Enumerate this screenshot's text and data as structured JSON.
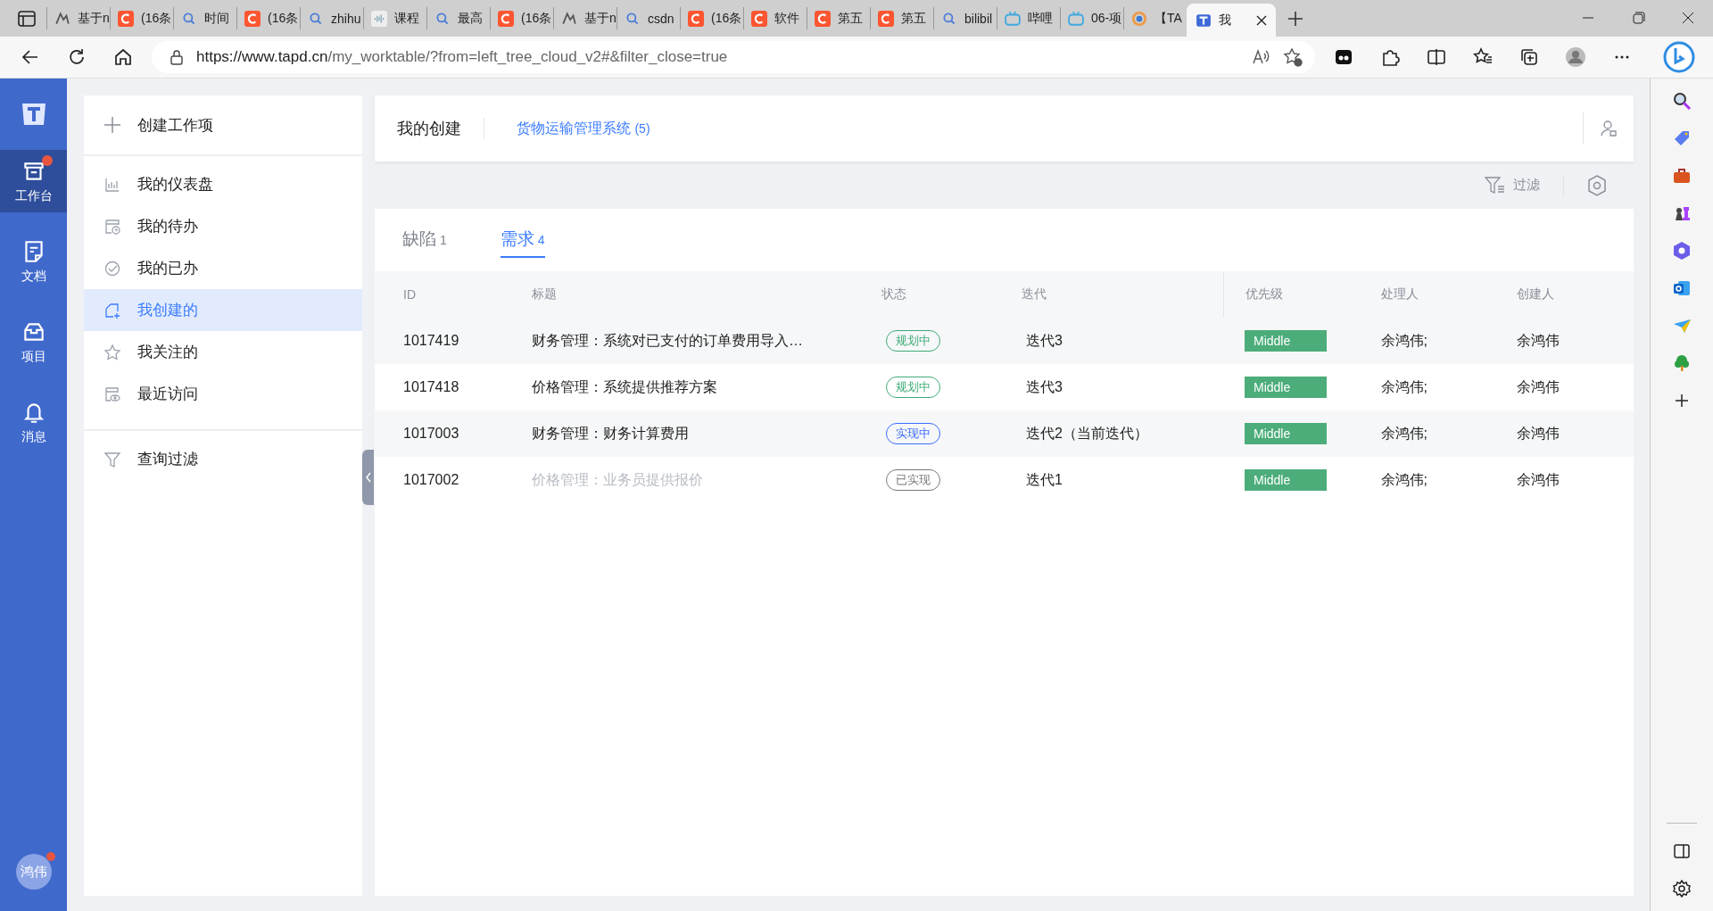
{
  "browser": {
    "tabs": [
      {
        "kind": "tapd",
        "title": "基于n",
        "selected": false
      },
      {
        "kind": "csdn",
        "title": "(16条",
        "selected": false
      },
      {
        "kind": "search",
        "title": "时间",
        "selected": false
      },
      {
        "kind": "csdn",
        "title": "(16条",
        "selected": false
      },
      {
        "kind": "search",
        "title": "zhihu",
        "selected": false
      },
      {
        "kind": "wave",
        "title": "课程",
        "selected": false
      },
      {
        "kind": "search",
        "title": "最高",
        "selected": false
      },
      {
        "kind": "csdn",
        "title": "(16条",
        "selected": false
      },
      {
        "kind": "tapd",
        "title": "基于n",
        "selected": false
      },
      {
        "kind": "search",
        "title": "csdn",
        "selected": false
      },
      {
        "kind": "csdn",
        "title": "(16条",
        "selected": false
      },
      {
        "kind": "csdn",
        "title": "软件",
        "selected": false
      },
      {
        "kind": "csdn",
        "title": "第五",
        "selected": false
      },
      {
        "kind": "csdn",
        "title": "第五",
        "selected": false
      },
      {
        "kind": "search",
        "title": "bilibil",
        "selected": false
      },
      {
        "kind": "tv",
        "title": "哔哩",
        "selected": false
      },
      {
        "kind": "tv",
        "title": "06-项",
        "selected": false
      },
      {
        "kind": "ring",
        "title": "【TA",
        "selected": false
      },
      {
        "kind": "logo",
        "title": "我",
        "selected": true
      }
    ],
    "url_host": "https://www.tapd.cn",
    "url_path": "/my_worktable/?from=left_tree_cloud_v2#&filter_close=true"
  },
  "nav": {
    "items": [
      {
        "kind": "archive",
        "label": "工作台",
        "selected": true,
        "badge": true
      },
      {
        "kind": "doc",
        "label": "文档",
        "selected": false,
        "badge": false
      },
      {
        "kind": "inbox",
        "label": "项目",
        "selected": false,
        "badge": false
      },
      {
        "kind": "bell",
        "label": "消息",
        "selected": false,
        "badge": false
      }
    ],
    "avatar": {
      "label": "鸿伟",
      "badge": true
    }
  },
  "sidebar": {
    "create": "创建工作项",
    "items": [
      {
        "kind": "chart",
        "label": "我的仪表盘",
        "selected": false
      },
      {
        "kind": "clock",
        "label": "我的待办",
        "selected": false
      },
      {
        "kind": "check",
        "label": "我的已办",
        "selected": false
      },
      {
        "kind": "newdoc",
        "label": "我创建的",
        "selected": true
      },
      {
        "kind": "star",
        "label": "我关注的",
        "selected": false
      },
      {
        "kind": "eye",
        "label": "最近访问",
        "selected": false
      }
    ],
    "filter": "查询过滤"
  },
  "header": {
    "title": "我的创建",
    "project": "货物运输管理系统",
    "count": "(5)"
  },
  "toolbar": {
    "filter": "过滤"
  },
  "tabs": [
    {
      "label": "缺陷",
      "count": "1",
      "selected": false
    },
    {
      "label": "需求",
      "count": "4",
      "selected": true
    }
  ],
  "table": {
    "columns": [
      "ID",
      "标题",
      "状态",
      "迭代",
      "优先级",
      "处理人",
      "创建人"
    ],
    "rows": [
      {
        "id": "1017419",
        "title": "财务管理：系统对已支付的订单费用导入…",
        "status": {
          "label": "规划中",
          "kind": "planning"
        },
        "iteration": "迭代3",
        "priority": "Middle",
        "handler": "余鸿伟;",
        "creator": "余鸿伟",
        "done": false
      },
      {
        "id": "1017418",
        "title": "价格管理：系统提供推荐方案",
        "status": {
          "label": "规划中",
          "kind": "planning"
        },
        "iteration": "迭代3",
        "priority": "Middle",
        "handler": "余鸿伟;",
        "creator": "余鸿伟",
        "done": false
      },
      {
        "id": "1017003",
        "title": "财务管理：财务计算费用",
        "status": {
          "label": "实现中",
          "kind": "doing"
        },
        "iteration": "迭代2（当前迭代）",
        "priority": "Middle",
        "handler": "余鸿伟;",
        "creator": "余鸿伟",
        "done": false
      },
      {
        "id": "1017002",
        "title": "价格管理：业务员提供报价",
        "status": {
          "label": "已实现",
          "kind": "done"
        },
        "iteration": "迭代1",
        "priority": "Middle",
        "handler": "余鸿伟;",
        "creator": "余鸿伟",
        "done": true
      }
    ]
  }
}
